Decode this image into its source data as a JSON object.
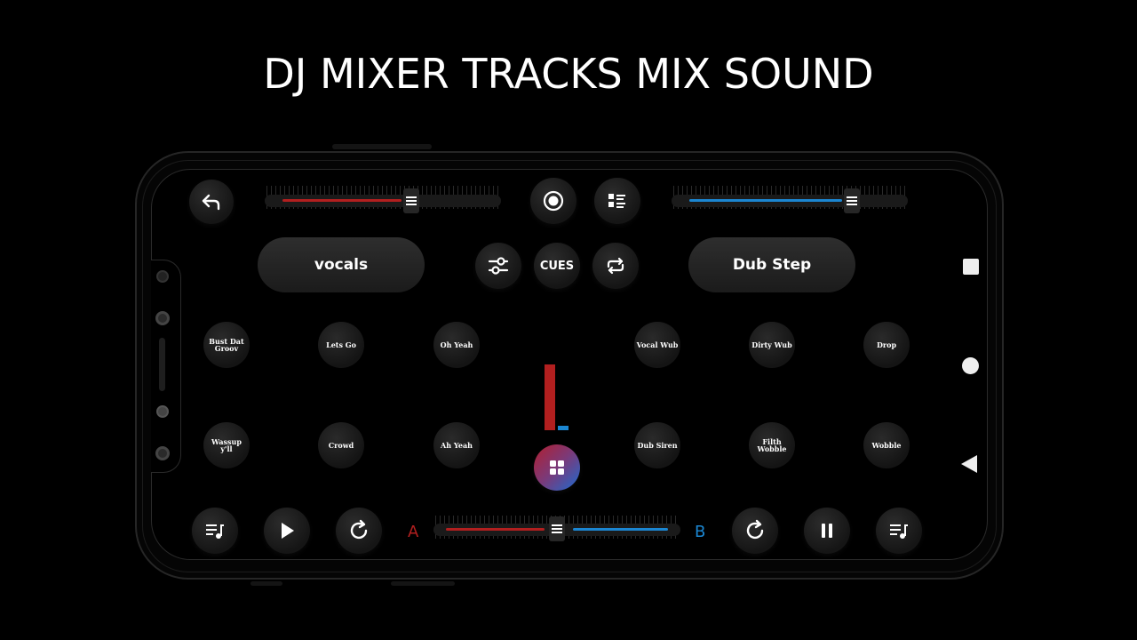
{
  "headline": "DJ MIXER TRACKS MIX SOUND",
  "deck_a": {
    "name": "vocals"
  },
  "deck_b": {
    "name": "Dub Step"
  },
  "center_controls": {
    "cues_label": "CUES"
  },
  "pads_left": [
    "Bust Dat Groov",
    "Lets Go",
    "Oh Yeah",
    "Wassup y'll",
    "Crowd",
    "Ah Yeah"
  ],
  "pads_right": [
    "Vocal Wub",
    "Dirty Wub",
    "Drop",
    "Dub Siren",
    "Filth Wobble",
    "Wobble"
  ],
  "crossfader": {
    "label_a": "A",
    "label_b": "B",
    "position": 0.5
  },
  "volume": {
    "deck_a": 0.62,
    "deck_b": 0.83
  },
  "level_meter": {
    "deck_a": 0.82,
    "deck_b": 0.05
  },
  "colors": {
    "deck_a": "#b21f1f",
    "deck_b": "#1b86d1",
    "background": "#000000"
  },
  "icons": {
    "back": "back-arrow-icon",
    "record": "record-icon",
    "playlist": "playlist-icon",
    "equalizer": "equalizer-icon",
    "loop": "loop-icon",
    "queue": "music-queue-icon",
    "play": "play-icon",
    "restart": "restart-icon",
    "pause": "pause-icon",
    "grid": "grid-icon"
  }
}
